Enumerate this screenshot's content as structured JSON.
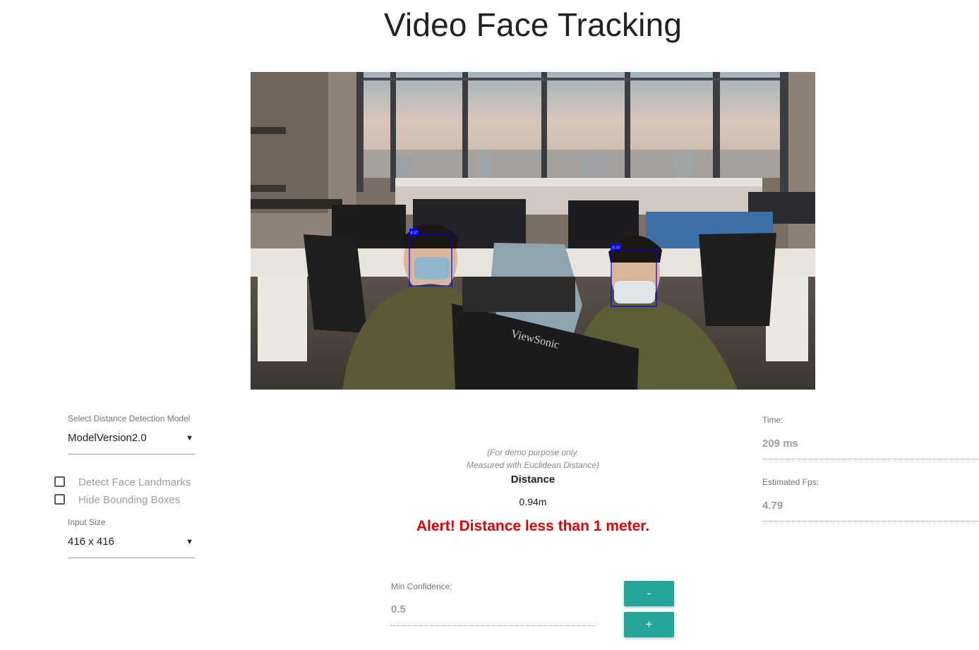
{
  "header": {
    "title": "Video Face Tracking"
  },
  "video": {
    "detections": [
      {
        "label": "0.37"
      },
      {
        "label": "0.33"
      }
    ],
    "monitor_brand": "ViewSonic",
    "colors": {
      "box": "#0000ff"
    }
  },
  "left_panel": {
    "model_select": {
      "label": "Select Distance Detection Model",
      "value": "ModelVersion2.0"
    },
    "checkboxes": [
      {
        "label": "Detect Face Landmarks",
        "checked": false
      },
      {
        "label": "Hide Bounding Boxes",
        "checked": false
      }
    ],
    "input_size": {
      "label": "Input Size",
      "value": "416 x 416"
    }
  },
  "center": {
    "note_line1": "(For demo purpose only.",
    "note_line2": "Measured with Euclidean Distance)",
    "distance_title": "Distance",
    "distance_value": "0.94m",
    "alert": "Alert! Distance less than 1 meter.",
    "alert_color": "#e60000",
    "min_confidence": {
      "label": "Min Confidence:",
      "value": "0.5"
    },
    "decrease_label": "-",
    "increase_label": "+",
    "button_color": "#26a69a"
  },
  "right_panel": {
    "time": {
      "label": "Time:",
      "value": "209 ms"
    },
    "fps": {
      "label": "Estimated Fps:",
      "value": "4.79"
    }
  }
}
